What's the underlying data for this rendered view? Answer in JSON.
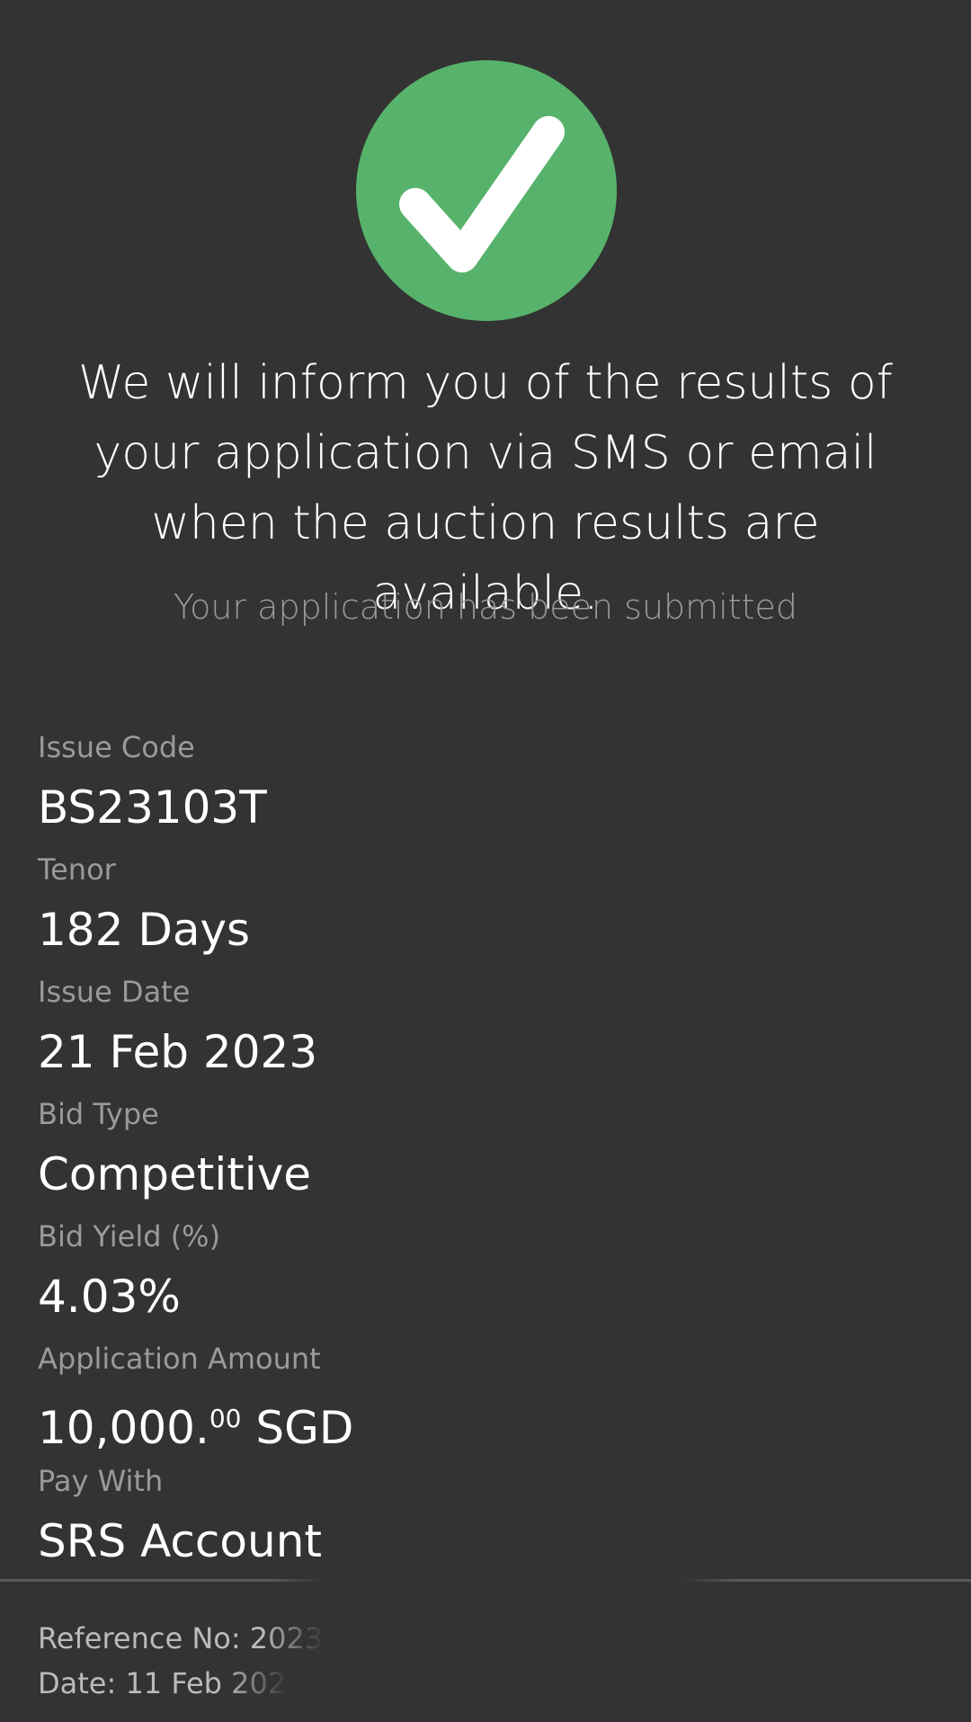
{
  "confirmation": {
    "icon": "check-circle-icon",
    "accent_color": "#57b36b",
    "message": "We will inform you of the results of your application via SMS or email when the auction results are available.",
    "status": "Your application has been submitted"
  },
  "details": [
    {
      "label": "Issue Code",
      "value": "BS23103T"
    },
    {
      "label": "Tenor",
      "value": "182 Days"
    },
    {
      "label": "Issue Date",
      "value": "21 Feb 2023"
    },
    {
      "label": "Bid Type",
      "value": "Competitive"
    },
    {
      "label": "Bid Yield (%)",
      "value": "4.03%"
    },
    {
      "label": "Application Amount",
      "amount_main": "10,000.",
      "amount_cents": "00",
      "currency": "SGD"
    },
    {
      "label": "Pay With",
      "value": "SRS Account"
    }
  ],
  "footer": {
    "reference": "Reference No: 2023",
    "date": "Date: 11 Feb 202"
  }
}
